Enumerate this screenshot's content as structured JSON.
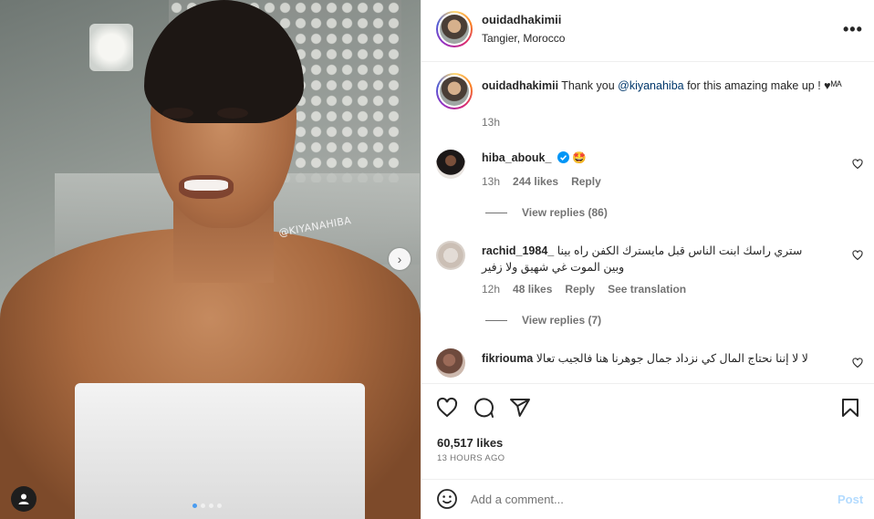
{
  "post": {
    "username": "ouidadhakimii",
    "location": "Tangier, Morocco",
    "watermark": "@KIYANAHIBA",
    "carousel": {
      "slides": 4,
      "active": 1
    }
  },
  "caption": {
    "username": "ouidadhakimii",
    "text_before": " Thank you ",
    "mention": "@kiyanahiba",
    "text_after": " for this amazing make up ! ♥ᴹᴬ",
    "time": "13h"
  },
  "comments": [
    {
      "username": "hiba_abouk_",
      "verified": true,
      "text": "🤩",
      "time": "13h",
      "likes": "244 likes",
      "reply": "Reply",
      "view_replies": "View replies (86)"
    },
    {
      "username": "rachid_1984_",
      "text": "ستري راسك ابنت الناس قبل مايسترك الكفن راه بينا وبين الموت غي شهيق ولا زفير",
      "time": "12h",
      "likes": "48 likes",
      "reply": "Reply",
      "translate": "See translation",
      "view_replies": "View replies (7)"
    },
    {
      "username": "fikriouma",
      "text": "لا لا إننا نحتاج المال كي نزداد جمال جوهرنا هنا فالجيب تعالا"
    }
  ],
  "actions": {
    "likes": "60,517 likes",
    "time_ago": "13 HOURS AGO"
  },
  "composer": {
    "placeholder": "Add a comment...",
    "post_label": "Post"
  },
  "colors": {
    "link": "#00376b",
    "verified": "#0095f6",
    "post_disabled": "#b3dbff",
    "muted": "#737373"
  },
  "icons": [
    "more-icon",
    "heart-icon",
    "comment-icon",
    "share-icon",
    "bookmark-icon",
    "emoji-icon",
    "next-arrow-icon",
    "user-tag-icon",
    "verified-icon"
  ]
}
